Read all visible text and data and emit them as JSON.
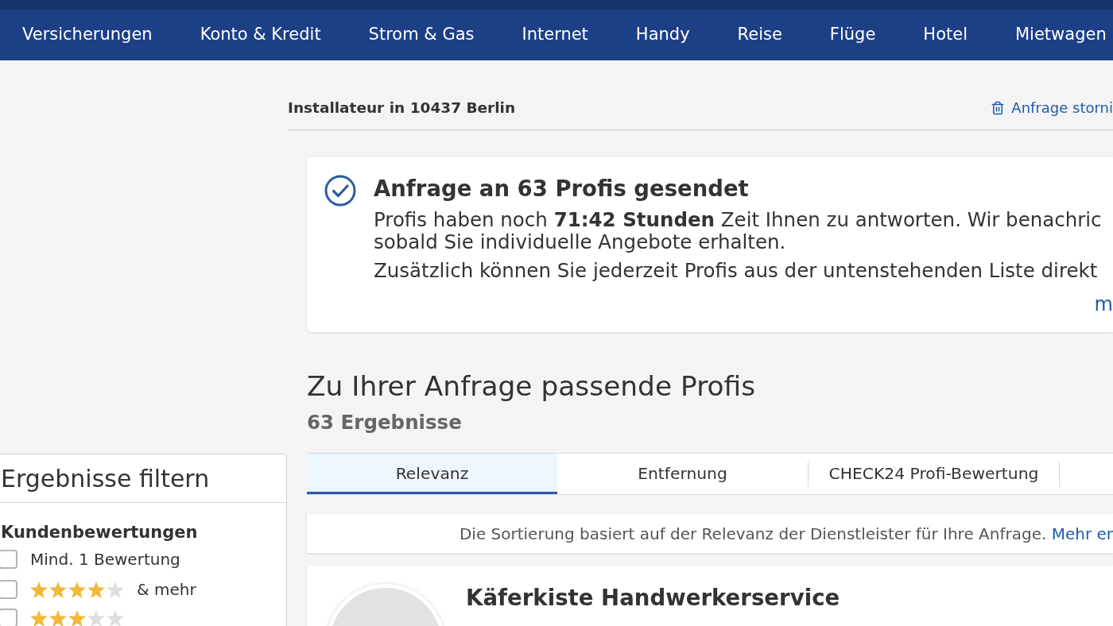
{
  "top_nav": {
    "items": [
      "Versicherungen",
      "Konto & Kredit",
      "Strom & Gas",
      "Internet",
      "Handy",
      "Reise",
      "Flüge",
      "Hotel",
      "Mietwagen"
    ]
  },
  "request_header": {
    "title": "Installateur in 10437 Berlin",
    "cancel_link": "Anfrage storni"
  },
  "notice": {
    "title": "Anfrage an 63 Profis gesendet",
    "text": "Profis haben noch **71:42 Stunden** Zeit Ihnen zu antworten. Wir benachric\nsobald Sie individuelle Angebote erhalten.",
    "text_2": "Zusätzlich können Sie jederzeit Profis aus der untenstehenden Liste direkt",
    "more_link": "m"
  },
  "results": {
    "heading": "Zu Ihrer Anfrage passende Profis",
    "count": "63 Ergebnisse",
    "sort_tabs": [
      {
        "label": "Relevanz",
        "selected": true
      },
      {
        "label": "Entfernung",
        "selected": false
      },
      {
        "label": "CHECK24 Profi-Bewertung",
        "selected": false
      }
    ],
    "sort_note": "Die Sortierung basiert auf der Relevanz der Dienstleister für Ihre Anfrage.",
    "sort_note_link": "Mehr er"
  },
  "filters": {
    "title": "Ergebnisse filtern",
    "section": "Kundenbewertungen",
    "options": [
      {
        "kind": "text",
        "label": "Mind. 1 Bewertung",
        "checked": false
      },
      {
        "kind": "stars",
        "stars": 4,
        "label": "& mehr",
        "checked": false
      },
      {
        "kind": "stars",
        "stars": 3,
        "checked": false
      }
    ]
  },
  "profiles": [
    {
      "name": "Käferkiste Handwerkerservice"
    }
  ]
}
